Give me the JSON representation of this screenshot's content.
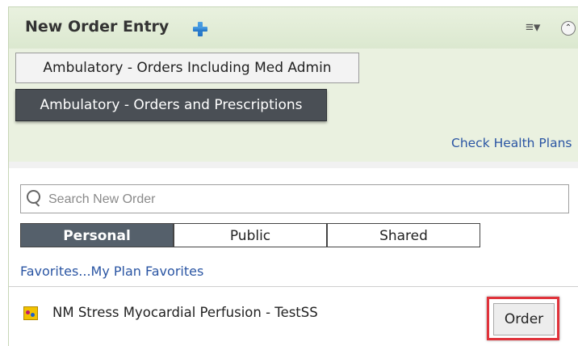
{
  "header": {
    "title": "New Order Entry",
    "icons": {
      "add": "plus-icon",
      "menu": "hamburger-menu-icon",
      "collapse": "collapse-up-icon"
    },
    "menu_glyph": "≡▾",
    "collapse_glyph": "⌃"
  },
  "order_sets": {
    "items": [
      {
        "label": "Ambulatory - Orders Including Med Admin",
        "selected": false
      },
      {
        "label": "Ambulatory - Orders and Prescriptions",
        "selected": true
      }
    ],
    "check_health_plans": "Check Health Plans"
  },
  "search": {
    "placeholder": "Search New Order",
    "value": ""
  },
  "tabs": [
    {
      "label": "Personal",
      "active": true
    },
    {
      "label": "Public",
      "active": false
    },
    {
      "label": "Shared",
      "active": false
    }
  ],
  "favorites_breadcrumb": "Favorites...My Plan Favorites",
  "orders": [
    {
      "name": "NM Stress Myocardial Perfusion - TestSS",
      "button_label": "Order"
    }
  ],
  "colors": {
    "accent_link": "#2a55a3",
    "highlight": "#e0323a",
    "header_bg": "#dbe8cf",
    "active_tab": "#55606b"
  }
}
